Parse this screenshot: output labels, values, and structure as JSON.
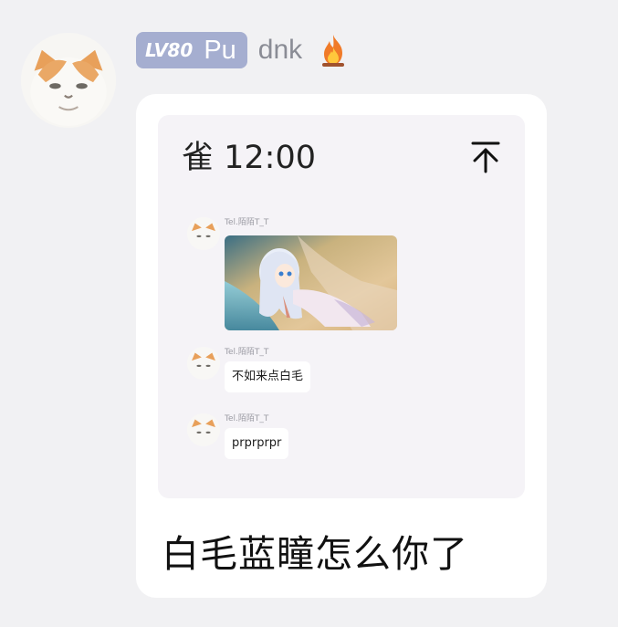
{
  "sender": {
    "avatar_icon": "cat-avatar-icon",
    "level_prefix": "LV",
    "level_number": "80",
    "level_title": "Pu",
    "name": "dnk",
    "badge_icon": "fire-icon"
  },
  "message": {
    "quoted_screenshot": {
      "status_text": "雀 12:00",
      "pin_icon": "pin-to-top-icon",
      "items": [
        {
          "sender": "Tel.陌陌T_T",
          "type": "image",
          "image_icon": "anime-girl-image"
        },
        {
          "sender": "Tel.陌陌T_T",
          "type": "text",
          "text": "不如来点白毛"
        },
        {
          "sender": "Tel.陌陌T_T",
          "type": "text",
          "text": "prprprpr"
        }
      ]
    },
    "caption": "白毛蓝瞳怎么你了"
  },
  "colors": {
    "page_background": "#f1f1f3",
    "level_badge": "#a5aed0",
    "username": "#8a8c95",
    "bubble": "#ffffff",
    "quote_card": "#f5f3f7"
  }
}
